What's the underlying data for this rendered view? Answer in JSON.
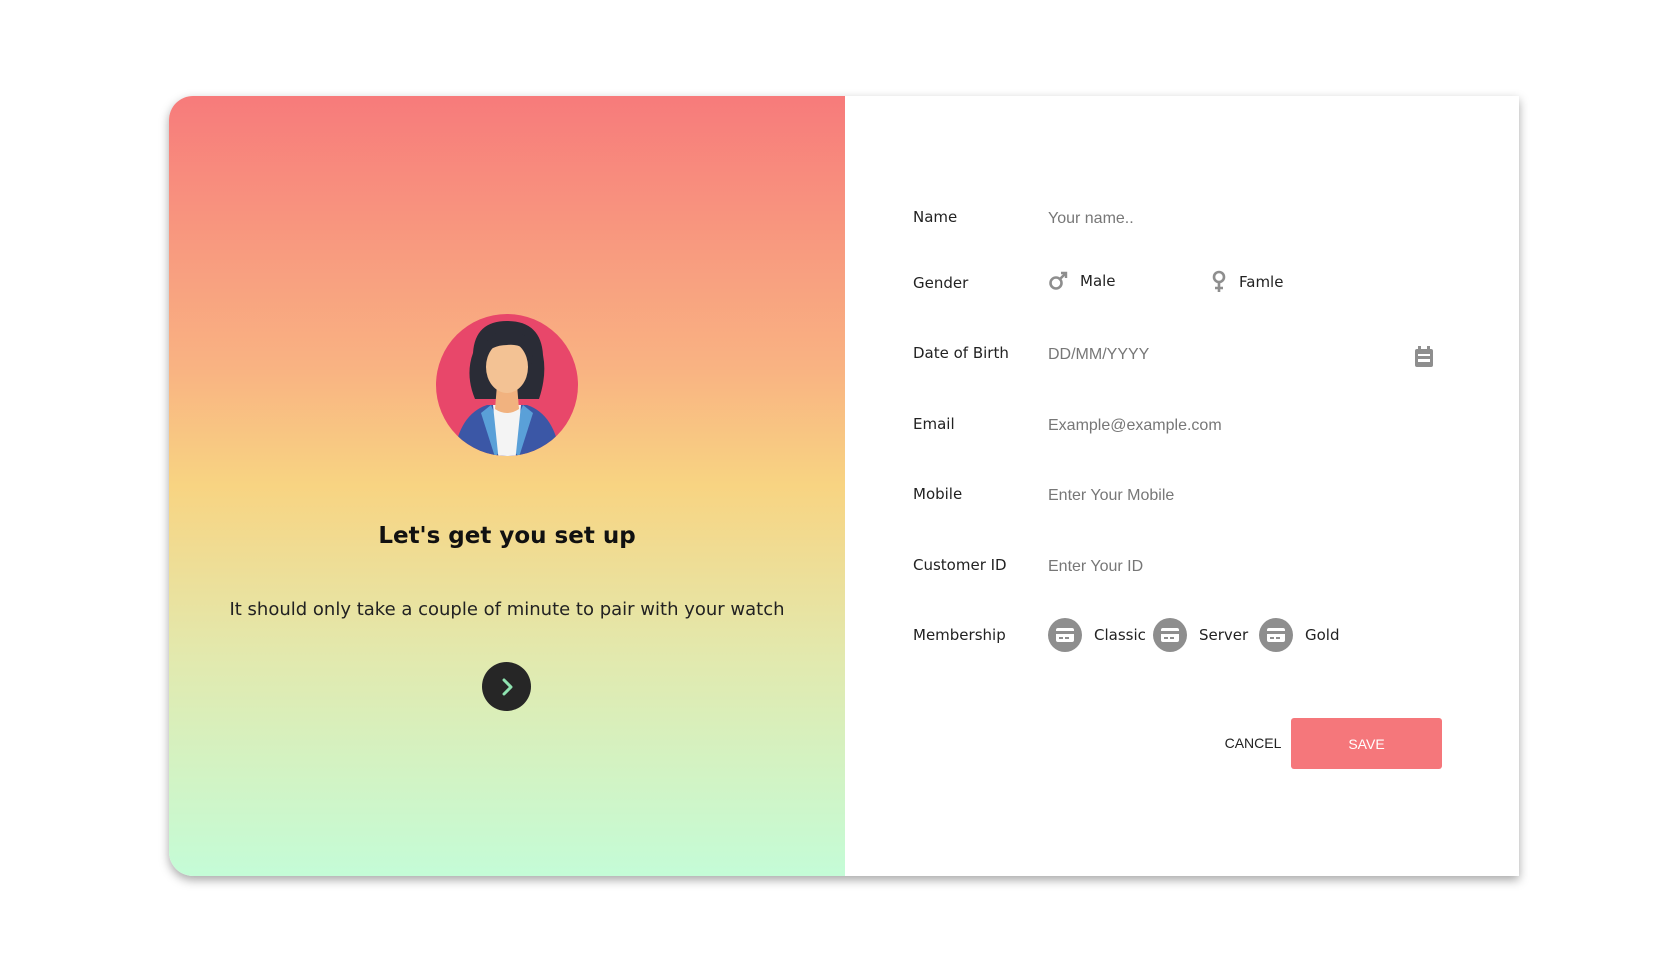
{
  "intro": {
    "title": "Let's get you set up",
    "subtitle": "It should only take a couple of minute to pair with your watch"
  },
  "form": {
    "name": {
      "label": "Name",
      "placeholder": "Your name.."
    },
    "gender": {
      "label": "Gender",
      "options": [
        {
          "label": "Male",
          "icon": "male-icon"
        },
        {
          "label": "Famle",
          "icon": "female-icon"
        }
      ]
    },
    "dob": {
      "label": "Date of Birth",
      "placeholder": "DD/MM/YYYY",
      "icon": "calendar-icon"
    },
    "email": {
      "label": "Email",
      "placeholder": "Example@example.com"
    },
    "mobile": {
      "label": "Mobile",
      "placeholder": "Enter Your Mobile"
    },
    "customer_id": {
      "label": "Customer ID",
      "placeholder": "Enter Your ID"
    },
    "membership": {
      "label": "Membership",
      "options": [
        {
          "label": "Classic",
          "icon": "card-icon"
        },
        {
          "label": "Server",
          "icon": "card-icon"
        },
        {
          "label": "Gold",
          "icon": "card-icon"
        }
      ]
    }
  },
  "actions": {
    "cancel_label": "CANCEL",
    "save_label": "SAVE"
  },
  "colors": {
    "accent": "#f5777b",
    "gradient_top": "#f77b7b",
    "gradient_mid": "#f8d482",
    "gradient_bottom": "#c4fcd7",
    "icon_grey": "#8e8e8e"
  }
}
